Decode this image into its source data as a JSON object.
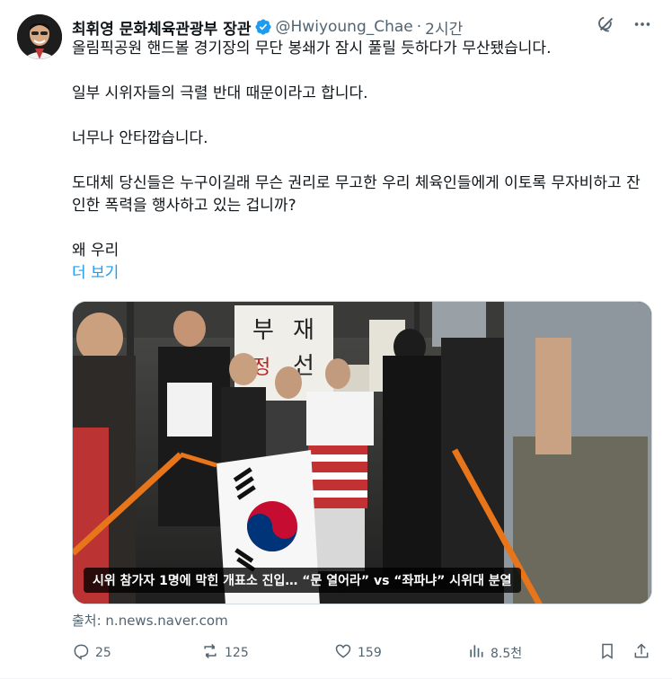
{
  "author": {
    "name": "최휘영 문화체육관광부 장관",
    "handle": "@Hwiyoung_Chae",
    "separator": "·",
    "time": "2시간"
  },
  "tweet": {
    "paragraphs": [
      "올림픽공원 핸드볼 경기장의 무단 봉쇄가 잠시 풀릴 듯하다가 무산됐습니다.",
      "일부 시위자들의 극렬 반대 때문이라고 합니다.",
      "너무나 안타깝습니다.",
      "도대체 당신들은 누구이길래 무슨 권리로 무고한 우리 체육인들에게 이토록 무자비하고 잔인한 폭력을 행사하고 있는 겁니까?",
      "왜 우리"
    ],
    "show_more": "더 보기"
  },
  "media": {
    "caption": "시위 참가자 1명에 막힌 개표소 진입… “문 열어라” vs “좌파냐” 시위대 분열",
    "banner_text": "부정선거 재선거"
  },
  "source": "출처: n.news.naver.com",
  "actions": {
    "replies": "25",
    "reposts": "125",
    "likes": "159",
    "views": "8.5천"
  },
  "colors": {
    "link": "#1d9bf0",
    "secondary": "#536471",
    "verified": "#1d9bf0"
  }
}
